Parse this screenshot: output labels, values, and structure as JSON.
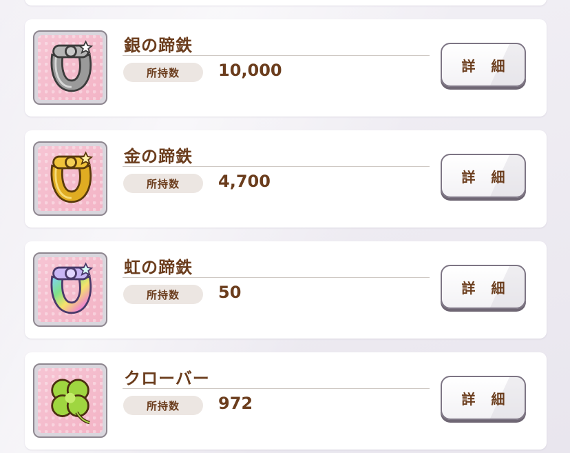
{
  "items": [
    {
      "name": "銀の蹄鉄",
      "qty_label": "所持数",
      "qty": "10,000",
      "detail_label": "詳 細",
      "icon": "silver-horseshoe-icon"
    },
    {
      "name": "金の蹄鉄",
      "qty_label": "所持数",
      "qty": "4,700",
      "detail_label": "詳 細",
      "icon": "gold-horseshoe-icon"
    },
    {
      "name": "虹の蹄鉄",
      "qty_label": "所持数",
      "qty": "50",
      "detail_label": "詳 細",
      "icon": "rainbow-horseshoe-icon"
    },
    {
      "name": "クローバー",
      "qty_label": "所持数",
      "qty": "972",
      "detail_label": "詳 細",
      "icon": "clover-icon"
    }
  ],
  "colors": {
    "text_brown": "#6b3d1d",
    "card_bg": "#ffffff",
    "icon_bg_pink": "#f3b4c6",
    "silver": "#8c8c8c",
    "gold": "#d8a21f"
  }
}
